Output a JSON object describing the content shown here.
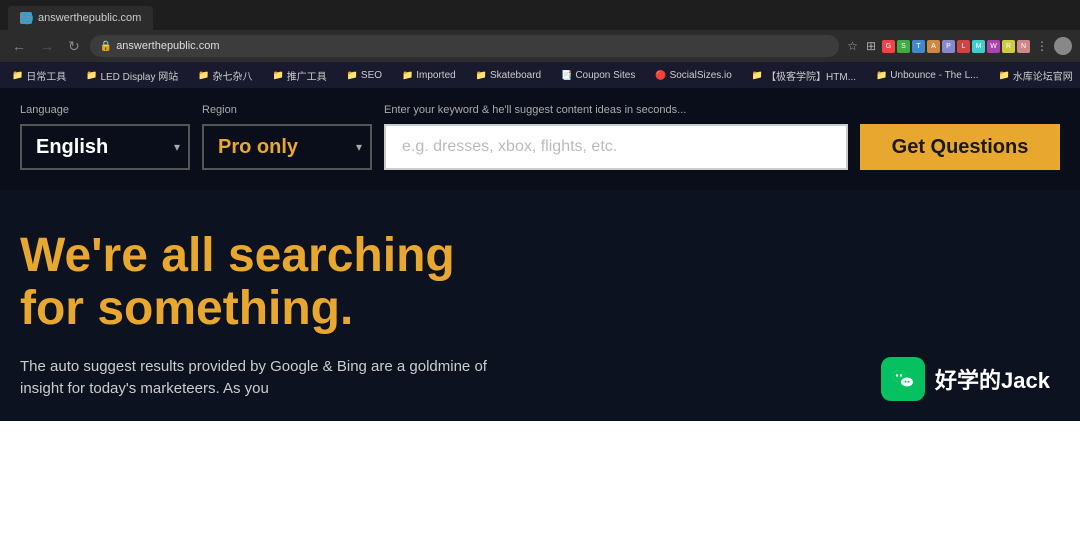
{
  "browser": {
    "tab": {
      "label": "answerthepublic.com",
      "favicon": "🌐"
    },
    "address": "answerthepublic.com",
    "nav_back_disabled": false,
    "nav_forward_disabled": true
  },
  "bookmarks": [
    {
      "label": "日常工具",
      "icon": "📁"
    },
    {
      "label": "LED Display 网站",
      "icon": "📁"
    },
    {
      "label": "杂七杂八",
      "icon": "📁"
    },
    {
      "label": "推广工具",
      "icon": "📁"
    },
    {
      "label": "SEO",
      "icon": "📁"
    },
    {
      "label": "Imported",
      "icon": "📁"
    },
    {
      "label": "Skateboard",
      "icon": "📁"
    },
    {
      "label": "Coupon Sites",
      "icon": "📑"
    },
    {
      "label": "SocialSizes.io",
      "icon": "🔴"
    },
    {
      "label": "【极客学院】HTM...",
      "icon": "📁"
    },
    {
      "label": "Unbounce - The L...",
      "icon": "📁"
    },
    {
      "label": "水库论坛官网",
      "icon": "📁"
    }
  ],
  "search_form": {
    "language_label": "Language",
    "region_label": "Region",
    "keyword_label": "Enter your keyword & he'll suggest content ideas in seconds...",
    "language_value": "English",
    "region_value": "Pro only",
    "keyword_placeholder": "e.g. dresses, xbox, flights, etc.",
    "button_label": "Get Questions"
  },
  "hero": {
    "headline": "We're all searching for something.",
    "body": "The auto suggest results provided by Google & Bing are a goldmine of insight for today's marketeers. As you"
  },
  "watermark": {
    "platform": "好学的Jack"
  }
}
